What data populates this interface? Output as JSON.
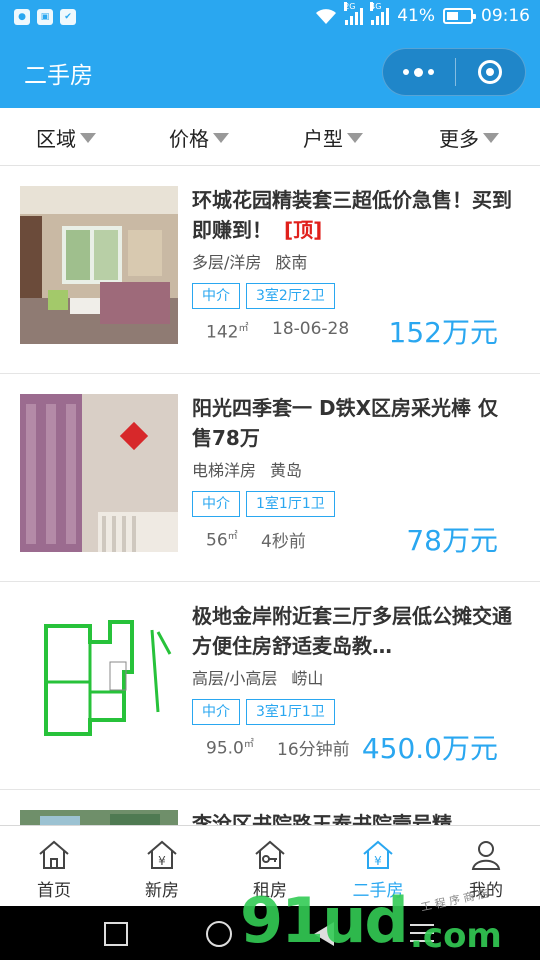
{
  "status_bar": {
    "network_1": "2G",
    "network_2": "4G",
    "battery": "41%",
    "time": "09:16"
  },
  "header": {
    "title": "二手房"
  },
  "filters": [
    {
      "label": "区域"
    },
    {
      "label": "价格"
    },
    {
      "label": "户型"
    },
    {
      "label": "更多"
    }
  ],
  "listings": [
    {
      "title": "环城花园精装套三超低价急售！买到即赚到！",
      "badge": "[顶]",
      "type": "多层/洋房",
      "location": "胶南",
      "tags": [
        "中介",
        "3室2厅2卫"
      ],
      "area": "142",
      "area_unit": "㎡",
      "date": "18-06-28",
      "price": "152万元"
    },
    {
      "title": "阳光四季套一 D铁X区房采光棒 仅售78万",
      "badge": "",
      "type": "电梯洋房",
      "location": "黄岛",
      "tags": [
        "中介",
        "1室1厅1卫"
      ],
      "area": "56",
      "area_unit": "㎡",
      "date": "4秒前",
      "price": "78万元"
    },
    {
      "title": "极地金岸附近套三厅多层低公摊交通方便住房舒适麦岛教…",
      "badge": "",
      "type": "高层/小高层",
      "location": "崂山",
      "tags": [
        "中介",
        "3室1厅1卫"
      ],
      "area": "95.0",
      "area_unit": "㎡",
      "date": "16分钟前",
      "price": "450.0万元"
    },
    {
      "title": "李沧区书院路王泰书院壹号精",
      "badge": "",
      "type": "",
      "location": "",
      "tags": [],
      "area": "",
      "area_unit": "",
      "date": "",
      "price": ""
    }
  ],
  "tabs": [
    {
      "label": "首页",
      "icon": "home-icon",
      "active": false
    },
    {
      "label": "新房",
      "icon": "new-house-icon",
      "active": false
    },
    {
      "label": "租房",
      "icon": "rent-icon",
      "active": false
    },
    {
      "label": "二手房",
      "icon": "second-hand-icon",
      "active": true
    },
    {
      "label": "我的",
      "icon": "profile-icon",
      "active": false
    }
  ],
  "watermark": {
    "main": "91ud",
    "suffix": ".com",
    "small": "工 程 序 商 店"
  },
  "colors": {
    "primary": "#2aa7f0",
    "badge_red": "#e0201b"
  }
}
